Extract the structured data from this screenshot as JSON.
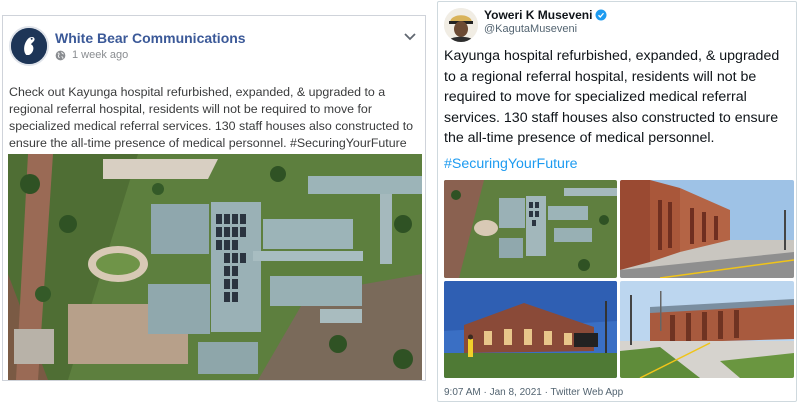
{
  "facebook_post": {
    "page_name": "White Bear Communications",
    "time": "1 week ago",
    "text": "Check out Kayunga hospital refurbished, expanded, & upgraded to a regional referral hospital, residents will not be required to move for specialized medical referral services. 130 staff houses also constructed to ensure the all-time presence of medical personnel. #SecuringYourFuture",
    "icons": {
      "avatar": "white-bear-logo-icon",
      "privacy": "globe-icon",
      "options": "chevron-down-icon"
    },
    "image": "aerial-hospital-photo"
  },
  "tweet": {
    "display_name": "Yoweri K Museveni",
    "handle": "@KagutaMuseveni",
    "verified": true,
    "text": "Kayunga hospital refurbished, expanded, & upgraded to a regional referral hospital, residents will not be required to move for specialized medical referral services. 130 staff houses also constructed to ensure the all-time presence of medical personnel.",
    "hashtag": "#SecuringYourFuture",
    "photos": [
      "aerial-hospital-photo",
      "brick-building-photo",
      "evening-building-photo",
      "hospital-entrance-photo"
    ],
    "footer": "9:07 AM · Jan 8, 2021 · Twitter Web App"
  },
  "colors": {
    "facebook_link": "#3b5998",
    "twitter_accent": "#1d9bf0",
    "verified_badge": "#1d9bf0"
  }
}
